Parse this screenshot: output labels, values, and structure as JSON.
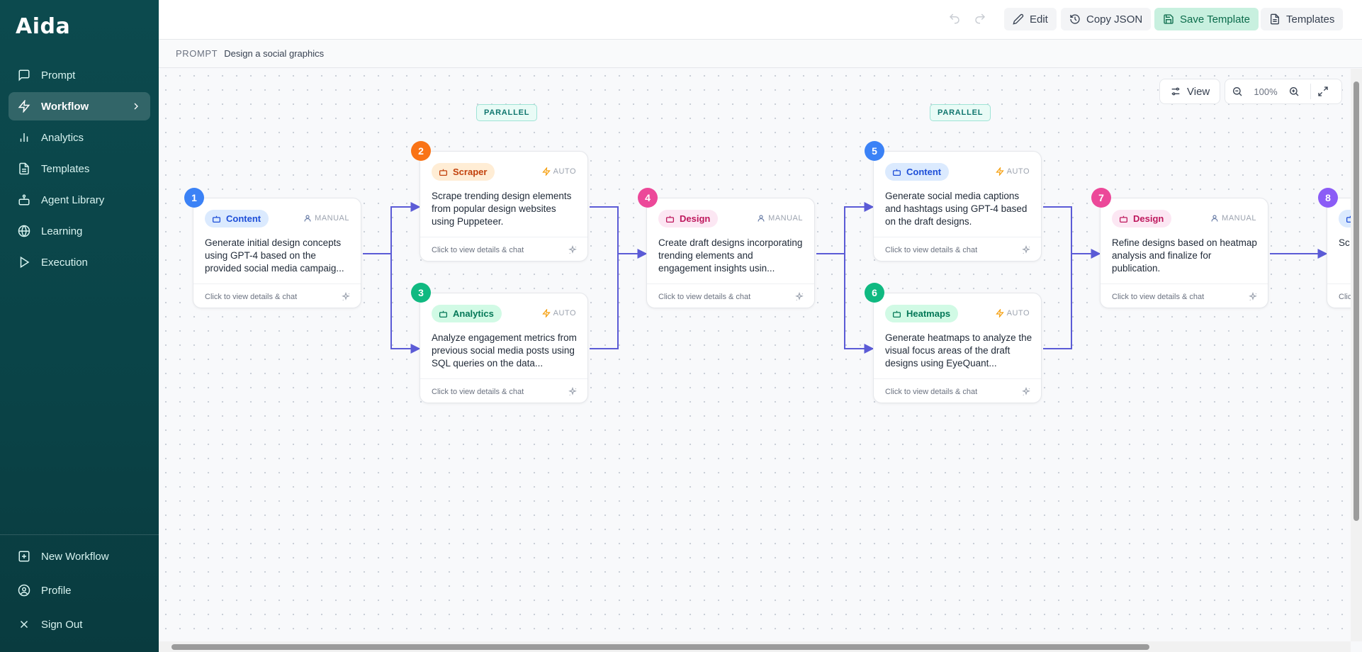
{
  "app": {
    "logo": "Aida"
  },
  "sidebar": {
    "items": [
      {
        "label": "Prompt",
        "icon": "message-square-icon"
      },
      {
        "label": "Workflow",
        "icon": "lightning-icon",
        "active": true
      },
      {
        "label": "Analytics",
        "icon": "bar-chart-icon"
      },
      {
        "label": "Templates",
        "icon": "file-text-icon"
      },
      {
        "label": "Agent Library",
        "icon": "bot-icon"
      },
      {
        "label": "Learning",
        "icon": "globe-icon"
      },
      {
        "label": "Execution",
        "icon": "play-icon"
      }
    ],
    "bottom": [
      {
        "label": "New Workflow",
        "icon": "plus-square-icon"
      },
      {
        "label": "Profile",
        "icon": "user-circle-icon"
      },
      {
        "label": "Sign Out",
        "icon": "x-icon"
      }
    ]
  },
  "toolbar": {
    "edit": "Edit",
    "copy_json": "Copy JSON",
    "save_template": "Save Template",
    "templates": "Templates"
  },
  "prompt": {
    "label": "PROMPT",
    "value": "Design a social graphics"
  },
  "canvas": {
    "view": "View",
    "zoom": "100%",
    "parallel_label": "PARALLEL"
  },
  "nodes": [
    {
      "num": "1",
      "agent": "Content",
      "mode": "MANUAL",
      "desc": "Generate initial design concepts using GPT-4 based on the provided social media campaig...",
      "footer": "Click to view details & chat",
      "color": "#3b82f6"
    },
    {
      "num": "2",
      "agent": "Scraper",
      "mode": "AUTO",
      "desc": "Scrape trending design elements from popular design websites using Puppeteer.",
      "footer": "Click to view details & chat",
      "color": "#f97316"
    },
    {
      "num": "3",
      "agent": "Analytics",
      "mode": "AUTO",
      "desc": "Analyze engagement metrics from previous social media posts using SQL queries on the data...",
      "footer": "Click to view details & chat",
      "color": "#10b981"
    },
    {
      "num": "4",
      "agent": "Design",
      "mode": "MANUAL",
      "desc": "Create draft designs incorporating trending elements and engagement insights usin...",
      "footer": "Click to view details & chat",
      "color": "#ec4899"
    },
    {
      "num": "5",
      "agent": "Content",
      "mode": "AUTO",
      "desc": "Generate social media captions and hashtags using GPT-4 based on the draft designs.",
      "footer": "Click to view details & chat",
      "color": "#3b82f6"
    },
    {
      "num": "6",
      "agent": "Heatmaps",
      "mode": "AUTO",
      "desc": "Generate heatmaps to analyze the visual focus areas of the draft designs using EyeQuant...",
      "footer": "Click to view details & chat",
      "color": "#10b981"
    },
    {
      "num": "7",
      "agent": "Design",
      "mode": "MANUAL",
      "desc": "Refine designs based on heatmap analysis and finalize for publication.",
      "footer": "Click to view details & chat",
      "color": "#ec4899"
    },
    {
      "num": "8",
      "agent": "",
      "mode": "",
      "desc": "Sc de me",
      "footer": "Clic",
      "color": "#8b5cf6"
    }
  ]
}
